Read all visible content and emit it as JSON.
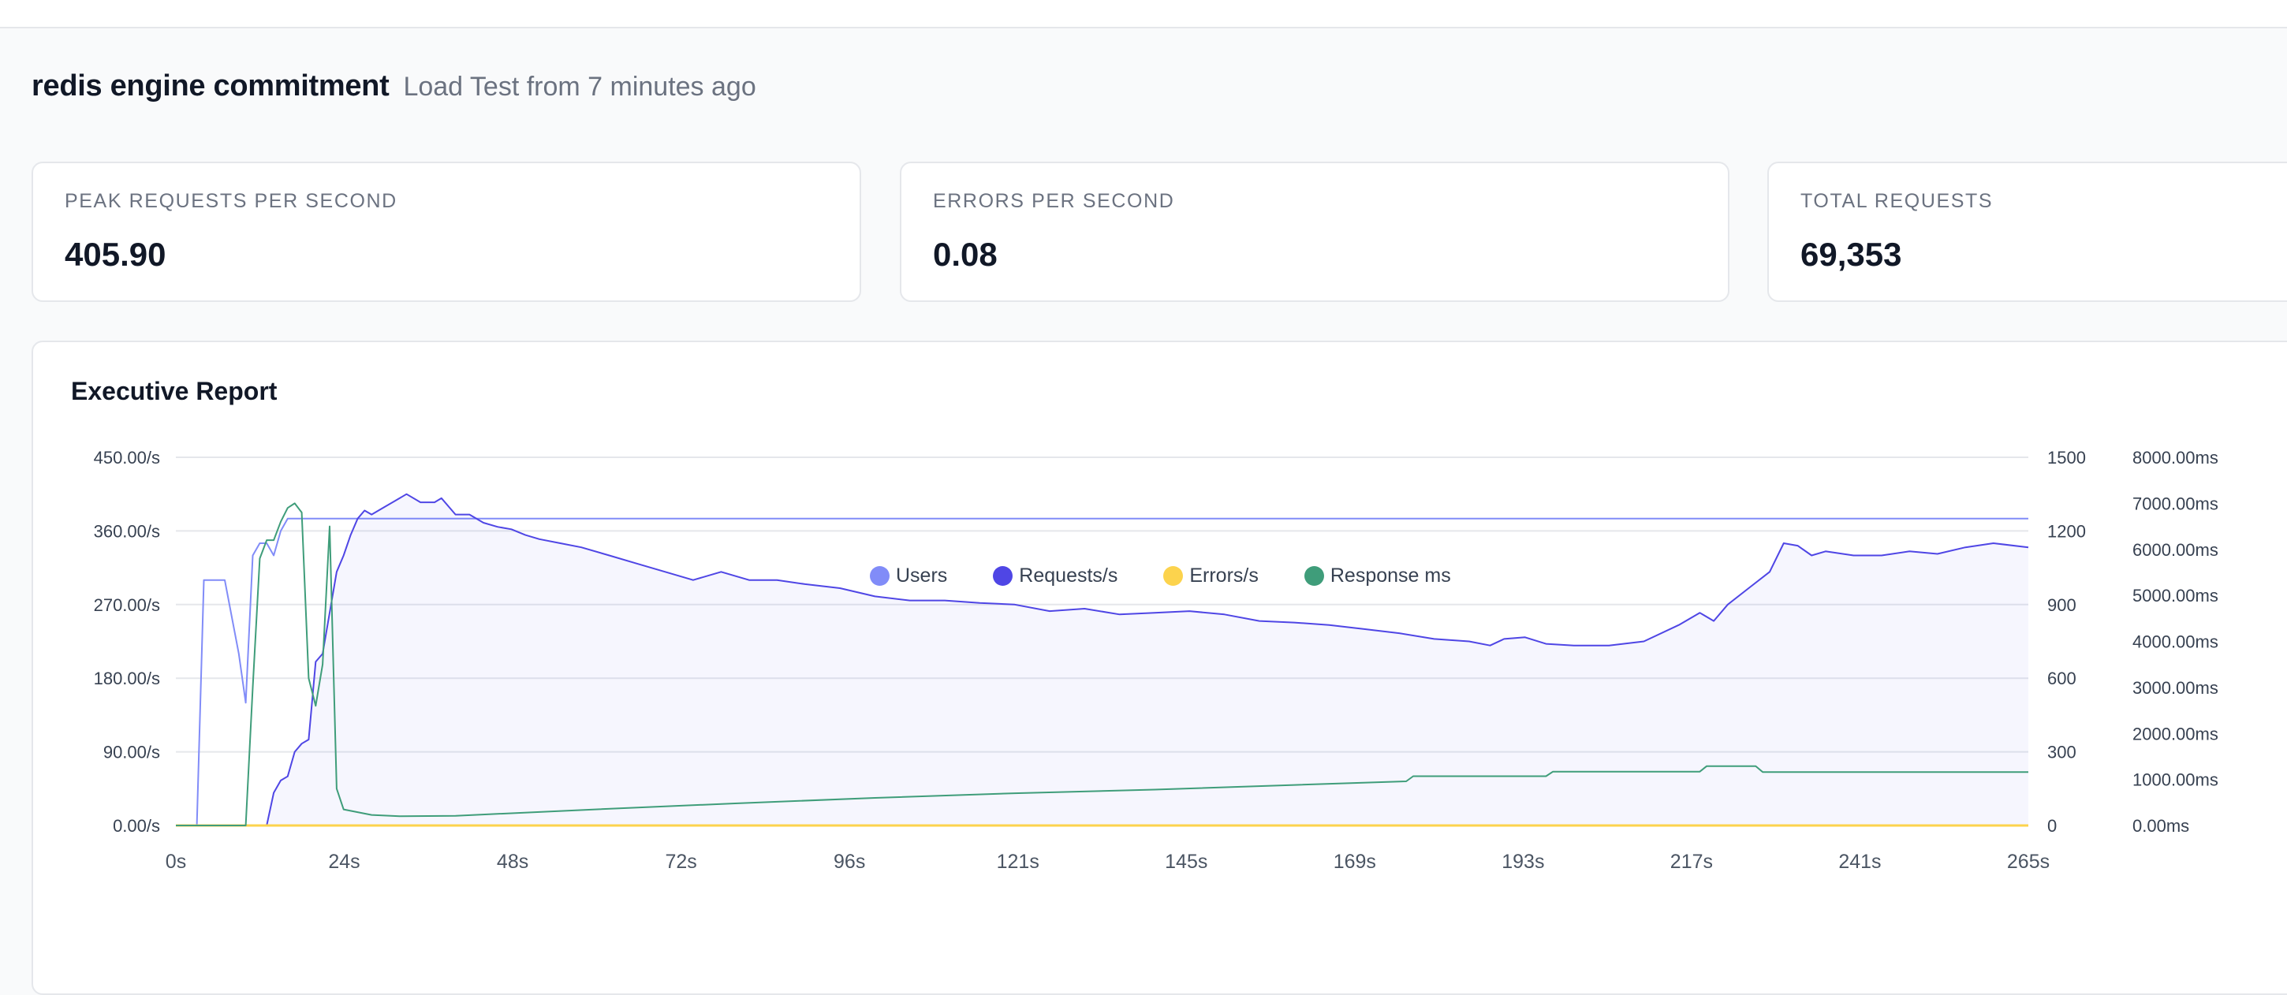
{
  "page": {
    "title": "redis engine commitment",
    "subtitle": "Load Test from 7 minutes ago"
  },
  "stats": [
    {
      "label": "PEAK REQUESTS PER SECOND",
      "value": "405.90"
    },
    {
      "label": "ERRORS PER SECOND",
      "value": "0.08"
    },
    {
      "label": "TOTAL REQUESTS",
      "value": "69,353"
    }
  ],
  "report": {
    "title": "Executive Report",
    "legend": [
      {
        "label": "Users",
        "color": "#818cf8"
      },
      {
        "label": "Requests/s",
        "color": "#4f46e5"
      },
      {
        "label": "Errors/s",
        "color": "#fcd34d"
      },
      {
        "label": "Response ms",
        "color": "#3f9d7a"
      }
    ]
  },
  "chart_data": {
    "type": "line",
    "left_axis_ticks": [
      "0.00/s",
      "90.00/s",
      "180.00/s",
      "270.00/s",
      "360.00/s",
      "450.00/s"
    ],
    "users_axis_ticks": [
      "0",
      "300",
      "600",
      "900",
      "1200",
      "1500"
    ],
    "response_axis_ticks": [
      "0.00ms",
      "1000.00ms",
      "2000.00ms",
      "3000.00ms",
      "4000.00ms",
      "5000.00ms",
      "6000.00ms",
      "7000.00ms",
      "8000.00ms"
    ],
    "x_ticks": [
      "0s",
      "24s",
      "48s",
      "72s",
      "96s",
      "121s",
      "145s",
      "169s",
      "193s",
      "217s",
      "241s",
      "265s"
    ],
    "xlim": [
      0,
      265
    ],
    "ylim_left": [
      0,
      450
    ],
    "ylim_users": [
      0,
      1500
    ],
    "ylim_response": [
      0,
      8000
    ],
    "grid": true,
    "legend_position": "bottom",
    "series": [
      {
        "name": "Users",
        "axis": "users",
        "x": [
          0,
          3,
          4,
          6,
          7,
          8,
          9,
          10,
          11,
          12,
          13,
          14,
          15,
          16,
          17,
          18,
          265
        ],
        "values": [
          0,
          0,
          1000,
          1000,
          1000,
          850,
          700,
          500,
          1100,
          1150,
          1150,
          1100,
          1200,
          1250,
          1250,
          1250,
          1250
        ]
      },
      {
        "name": "Requests/s",
        "axis": "left",
        "x": [
          0,
          13,
          14,
          15,
          16,
          17,
          18,
          19,
          20,
          21,
          22,
          23,
          24,
          25,
          26,
          27,
          28,
          30,
          32,
          33,
          35,
          37,
          38,
          40,
          42,
          44,
          46,
          48,
          50,
          52,
          55,
          58,
          62,
          66,
          70,
          74,
          78,
          82,
          86,
          90,
          95,
          100,
          105,
          110,
          115,
          120,
          125,
          130,
          135,
          140,
          145,
          150,
          155,
          160,
          165,
          170,
          175,
          180,
          185,
          188,
          190,
          193,
          196,
          200,
          205,
          210,
          215,
          218,
          220,
          222,
          225,
          228,
          230,
          232,
          234,
          236,
          240,
          244,
          248,
          252,
          256,
          260,
          265
        ],
        "values": [
          0,
          0,
          40,
          55,
          60,
          90,
          100,
          105,
          200,
          210,
          260,
          310,
          330,
          355,
          375,
          385,
          380,
          390,
          400,
          405,
          395,
          395,
          400,
          380,
          380,
          370,
          365,
          362,
          355,
          350,
          345,
          340,
          330,
          320,
          310,
          300,
          310,
          300,
          300,
          295,
          290,
          280,
          275,
          275,
          272,
          270,
          262,
          265,
          258,
          260,
          262,
          258,
          250,
          248,
          245,
          240,
          235,
          228,
          225,
          220,
          228,
          230,
          222,
          220,
          220,
          225,
          245,
          260,
          250,
          270,
          290,
          310,
          345,
          342,
          330,
          335,
          330,
          330,
          335,
          332,
          340,
          345,
          340
        ]
      },
      {
        "name": "Errors/s",
        "axis": "left",
        "x": [
          0,
          265
        ],
        "values": [
          0,
          0
        ]
      },
      {
        "name": "Response ms",
        "axis": "response",
        "x": [
          0,
          10,
          11,
          12,
          13,
          14,
          15,
          16,
          17,
          18,
          19,
          20,
          21,
          22,
          23,
          24,
          28,
          32,
          40,
          60,
          80,
          100,
          120,
          140,
          160,
          176,
          177,
          196,
          197,
          218,
          219,
          226,
          227,
          265
        ],
        "values": [
          0,
          0,
          3000,
          5800,
          6200,
          6200,
          6600,
          6900,
          7000,
          6800,
          3200,
          2600,
          3500,
          6500,
          800,
          350,
          230,
          200,
          210,
          350,
          480,
          600,
          700,
          780,
          880,
          960,
          1070,
          1070,
          1170,
          1170,
          1290,
          1290,
          1160,
          1160
        ]
      }
    ]
  }
}
